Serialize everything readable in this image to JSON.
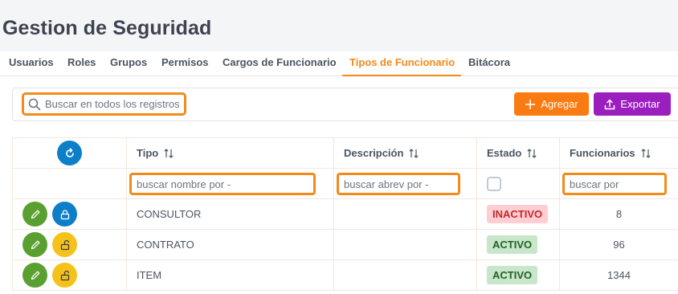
{
  "page": {
    "title": "Gestion de Seguridad"
  },
  "tabs": [
    {
      "label": "Usuarios",
      "active": false
    },
    {
      "label": "Roles",
      "active": false
    },
    {
      "label": "Grupos",
      "active": false
    },
    {
      "label": "Permisos",
      "active": false
    },
    {
      "label": "Cargos de Funcionario",
      "active": false
    },
    {
      "label": "Tipos de Funcionario",
      "active": true
    },
    {
      "label": "Bitácora",
      "active": false
    }
  ],
  "toolbar": {
    "search_placeholder": "Buscar en todos los registros",
    "add_label": "Agregar",
    "export_label": "Exportar"
  },
  "table": {
    "columns": [
      "Tipo",
      "Descripción",
      "Estado",
      "Funcionarios"
    ],
    "filters": {
      "tipo_placeholder": "buscar nombre por -",
      "descripcion_placeholder": "buscar abrev por -",
      "funcionarios_placeholder": "buscar por",
      "estado_checked": false
    },
    "rows": [
      {
        "tipo": "CONSULTOR",
        "descripcion": "",
        "estado": "INACTIVO",
        "funcionarios": "8",
        "lock": "locked"
      },
      {
        "tipo": "CONTRATO",
        "descripcion": "",
        "estado": "ACTIVO",
        "funcionarios": "96",
        "lock": "unlocked"
      },
      {
        "tipo": "ITEM",
        "descripcion": "",
        "estado": "ACTIVO",
        "funcionarios": "1344",
        "lock": "unlocked"
      }
    ]
  },
  "colors": {
    "accent": "#f28a1c",
    "add_button": "#f97b12",
    "export_button": "#9b1fbf",
    "edit_button": "#5aa030",
    "locked_button": "#0d7fc9",
    "unlocked_button": "#f5c21c",
    "inactive_badge": "#ffcdd2",
    "active_badge": "#c8e6c9"
  },
  "icons": {
    "search": "search-icon",
    "add": "plus-icon",
    "export": "upload-icon",
    "refresh": "refresh-icon",
    "sort": "sort-icon",
    "edit": "pencil-icon",
    "lock": "lock-icon",
    "unlock": "unlock-icon"
  }
}
